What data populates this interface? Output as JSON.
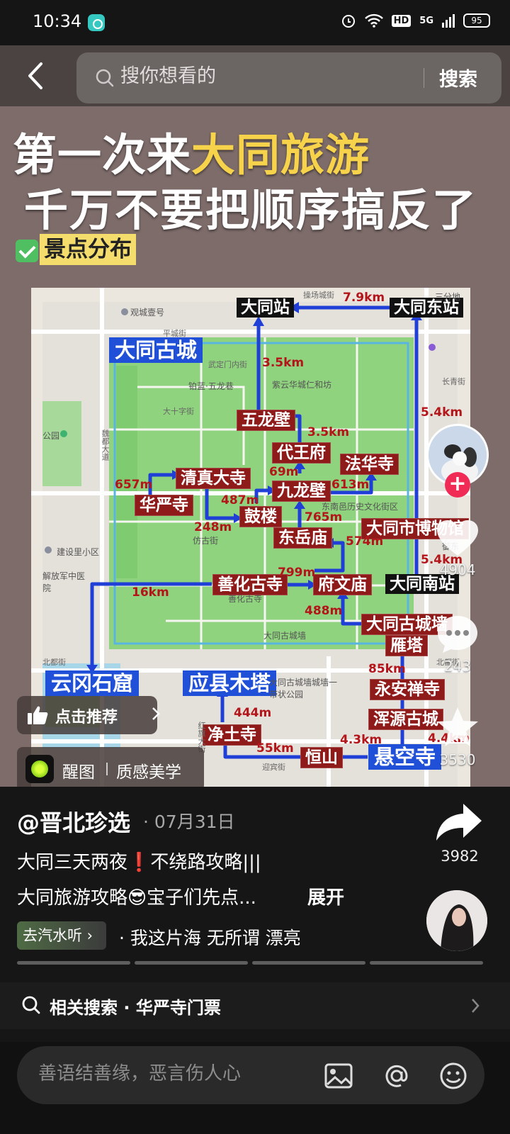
{
  "status_bar": {
    "time": "10:34",
    "hd": "HD",
    "signal": "5G",
    "battery": "95"
  },
  "search": {
    "placeholder": "搜你想看的",
    "button_label": "搜索"
  },
  "post": {
    "headline_white": "第一次来",
    "headline_yellow": "大同旅游",
    "headline_line2": "千万不要把顺序搞反了",
    "section_label": "景点分布",
    "map": {
      "attractions": [
        "大同站",
        "大同东站",
        "大同古城",
        "五龙壁",
        "代王府",
        "清真大寺",
        "法华寺",
        "九龙壁",
        "华严寺",
        "鼓楼",
        "东岳庙",
        "大同市博物馆",
        "大同南站",
        "善化古寺",
        "府文庙",
        "大同古城墙",
        "雁塔",
        "永安禅寺",
        "浑源古城",
        "云冈石窟",
        "应县木塔",
        "净土寺",
        "恒山",
        "悬空寺"
      ],
      "distances": [
        "7.9km",
        "3.5km",
        "5.4km",
        "3.5km",
        "69m",
        "613m",
        "657m",
        "487m",
        "248m",
        "765m",
        "574m",
        "5.4km",
        "799m",
        "16km",
        "488m",
        "85km",
        "444m",
        "4.3km",
        "4.4km",
        "55km"
      ],
      "pois": [
        "观城壹号",
        "紫云华城仁和坊",
        "铂蓝·五龙巷",
        "东南邑历史文化街区",
        "仿古街",
        "建设里小区",
        "解放军中医院",
        "大同古城墙",
        "善化古寺",
        "大同古城墙城墙一带状公园",
        "三分地",
        "御东",
        "公园"
      ],
      "roads": [
        "平城街",
        "操场城街",
        "武定门内街",
        "大十字街",
        "魏都大道",
        "北都街",
        "红旗大街",
        "迎宾街",
        "长青街",
        "北都街"
      ]
    }
  },
  "overlay": {
    "recommend_label": "点击推荐",
    "filter_app": "醒图",
    "filter_name": "质感美学"
  },
  "actions": {
    "likes": "4904",
    "comments": "243",
    "favorites": "3530",
    "shares": "3982"
  },
  "info": {
    "author": "@晋北珍选",
    "date": "· 07月31日",
    "desc_line1": "大同三天两夜❗不绕路攻略|||",
    "desc_line2": "大同旅游攻略😎宝子们先点...",
    "expand_label": "展开",
    "music_chip": "去汽水听",
    "music_title": "· 我这片海    无所谓 漂亮",
    "related_search": "相关搜索 · 华严寺门票"
  },
  "comment": {
    "placeholder": "善语结善缘，恶言伤人心"
  },
  "colors": {
    "accent_yellow": "#f7d24b",
    "map_route_blue": "#1f3fd6",
    "label_red": "#8e1a1a",
    "follow_pink": "#f02c56"
  }
}
